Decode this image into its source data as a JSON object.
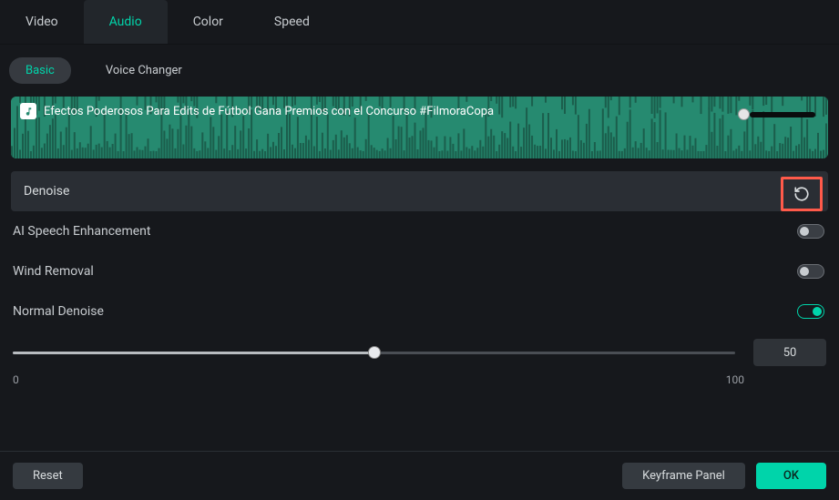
{
  "tabs": {
    "video": "Video",
    "audio": "Audio",
    "color": "Color",
    "speed": "Speed"
  },
  "subtabs": {
    "basic": "Basic",
    "voice_changer": "Voice Changer"
  },
  "clip": {
    "title": "Efectos Poderosos Para Edits de Fútbol   Gana Premios con el Concurso #FilmoraCopa"
  },
  "denoise": {
    "header": "Denoise",
    "ai_speech": "AI Speech Enhancement",
    "wind_removal": "Wind Removal",
    "normal": "Normal Denoise",
    "value": "50",
    "min": "0",
    "max": "100",
    "normal_on": true,
    "slider_percent": 50
  },
  "footer": {
    "reset": "Reset",
    "keyframe": "Keyframe Panel",
    "ok": "OK"
  }
}
